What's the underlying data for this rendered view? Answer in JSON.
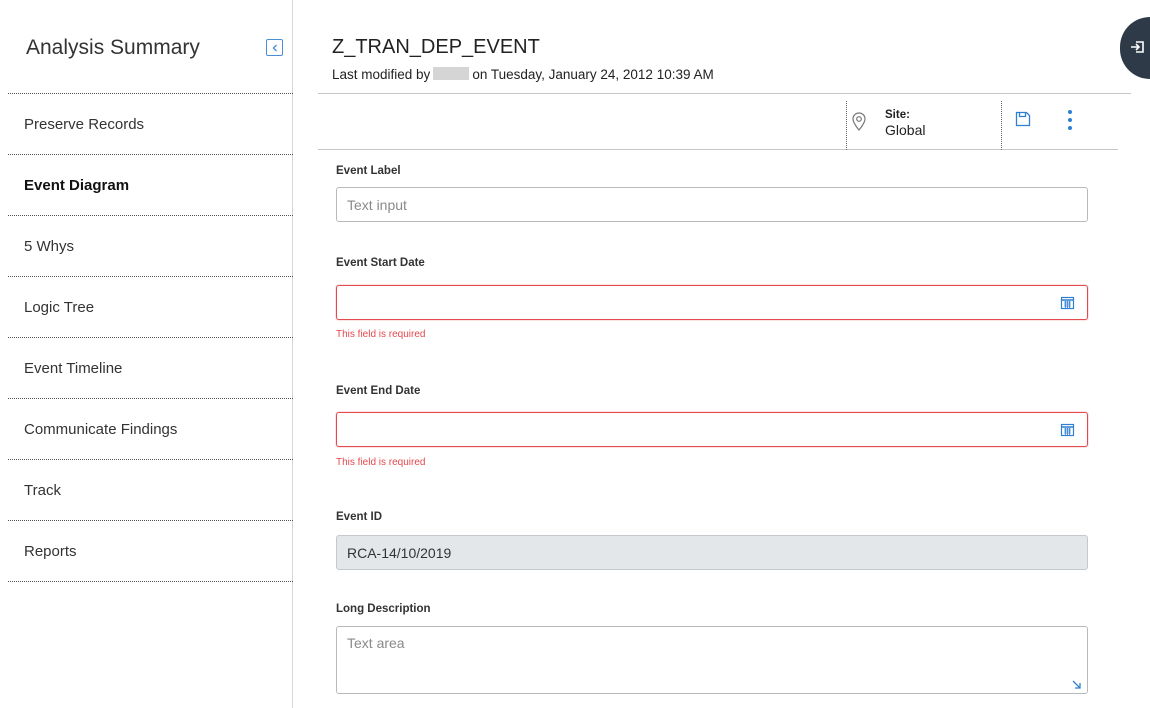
{
  "sidebar": {
    "title": "Analysis Summary",
    "items": [
      {
        "label": "Preserve Records"
      },
      {
        "label": "Event Diagram"
      },
      {
        "label": "5 Whys"
      },
      {
        "label": "Logic Tree"
      },
      {
        "label": "Event Timeline"
      },
      {
        "label": "Communicate Findings"
      },
      {
        "label": "Track"
      },
      {
        "label": "Reports"
      }
    ],
    "active_index": 1
  },
  "header": {
    "title": "Z_TRAN_DEP_EVENT",
    "meta_prefix": "Last modified by",
    "meta_suffix": "on Tuesday, January 24, 2012 10:39 AM"
  },
  "toolbar": {
    "site_label": "Site:",
    "site_value": "Global",
    "icons": [
      "map-pin-icon",
      "save-icon",
      "kebab-menu-icon"
    ]
  },
  "form": {
    "event_label": {
      "label": "Event Label",
      "placeholder": "Text input",
      "value": ""
    },
    "event_start_date": {
      "label": "Event Start Date",
      "value": "",
      "error": "This field is required"
    },
    "event_end_date": {
      "label": "Event End Date",
      "value": "",
      "error": "This field is required"
    },
    "event_id": {
      "label": "Event ID",
      "value": "RCA-14/10/2019"
    },
    "long_description": {
      "label": "Long Description",
      "placeholder": "Text area",
      "value": ""
    }
  },
  "colors": {
    "accent": "#2f7fd1",
    "error": "#e5484d",
    "right_tab": "#2e3a47",
    "readonly_bg": "#e4e7ea"
  }
}
